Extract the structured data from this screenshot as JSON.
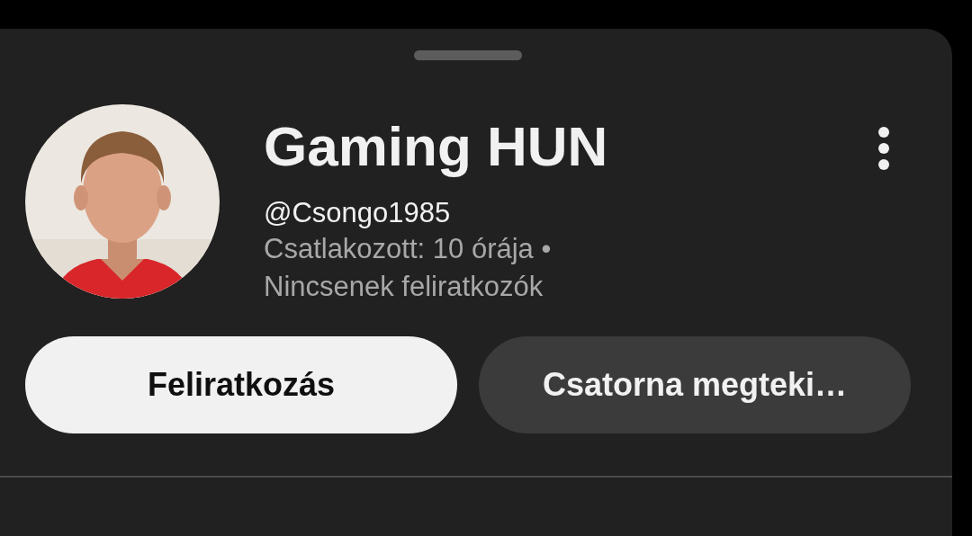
{
  "channel": {
    "name": "Gaming HUN",
    "handle": "@Csongo1985",
    "meta": [
      "Csatlakozott: 10 órája •",
      "Nincsenek feliratkozók"
    ]
  },
  "buttons": [
    {
      "label": "Feliratkozás",
      "kind": "primary"
    },
    {
      "label": "Csatorna megteki…",
      "kind": "secondary"
    }
  ]
}
